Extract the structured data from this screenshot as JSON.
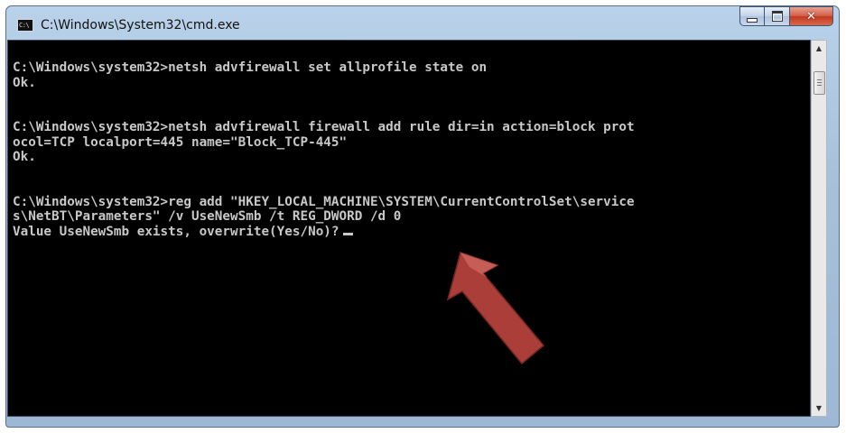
{
  "window": {
    "title": "C:\\Windows\\System32\\cmd.exe",
    "icon_label": "C:\\",
    "buttons": {
      "minimize": "minimize-icon",
      "maximize": "maximize-icon",
      "close": "close-icon"
    }
  },
  "console": {
    "lines": [
      "C:\\Windows\\system32>netsh advfirewall set allprofile state on",
      "Ok.",
      "",
      "",
      "C:\\Windows\\system32>netsh advfirewall firewall add rule dir=in action=block prot",
      "ocol=TCP localport=445 name=\"Block_TCP-445\"",
      "Ok.",
      "",
      "",
      "C:\\Windows\\system32>reg add \"HKEY_LOCAL_MACHINE\\SYSTEM\\CurrentControlSet\\service",
      "s\\NetBT\\Parameters\" /v UseNewSmb /t REG_DWORD /d 0",
      "Value UseNewSmb exists, overwrite(Yes/No)?"
    ],
    "text_color": "#c8c8c8",
    "background_color": "#000000"
  },
  "annotation": {
    "arrow_color": "#b5423c",
    "icon": "pointer-arrow-icon"
  },
  "scrollbar": {
    "up_icon": "scroll-up-icon",
    "down_icon": "scroll-down-icon"
  }
}
